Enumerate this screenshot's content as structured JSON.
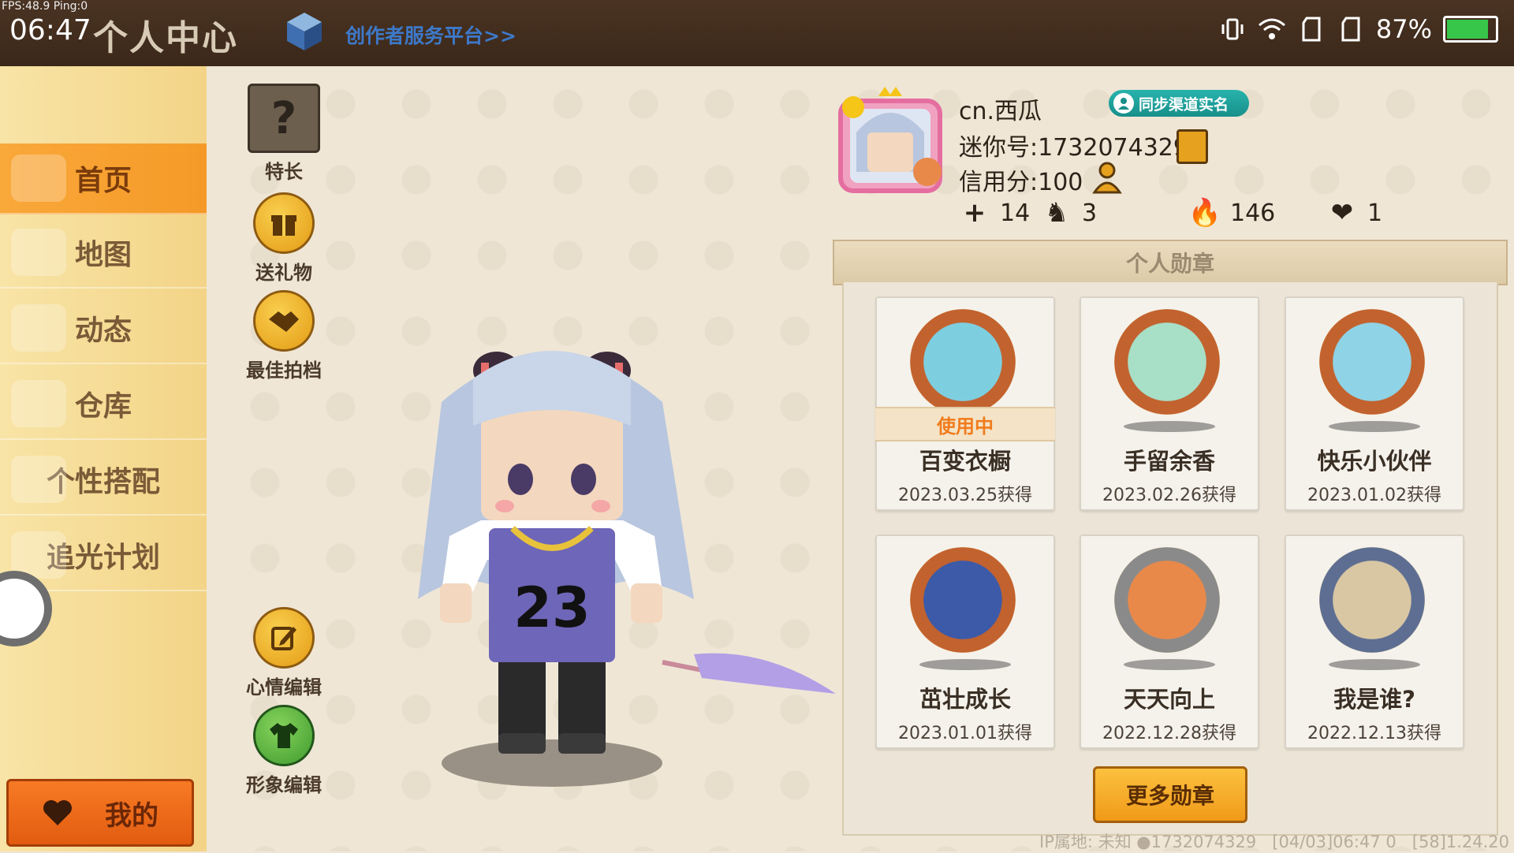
{
  "status_bar": {
    "fps": "FPS:48.9  Ping:0",
    "time": "06:47",
    "battery": "87%"
  },
  "header": {
    "title": "个人中心",
    "creator_link": "创作者服务平台>>"
  },
  "nav": {
    "items": [
      {
        "label": "首页",
        "active": true
      },
      {
        "label": "地图"
      },
      {
        "label": "动态"
      },
      {
        "label": "仓库"
      },
      {
        "label": "个性搭配"
      },
      {
        "label": "追光计划"
      }
    ],
    "mine": "我的"
  },
  "tools": {
    "specialty": "特长",
    "specialty_glyph": "?",
    "gift": "送礼物",
    "best_partner": "最佳拍档",
    "mood_edit": "心情编辑",
    "avatar_edit": "形象编辑"
  },
  "profile": {
    "nickname": "cn.西瓜",
    "sync_label": "同步渠道实名",
    "mini_id": "迷你号:1732074329",
    "credit": "信用分:100",
    "stats": [
      {
        "icon": "add-friend-icon",
        "glyph": "+",
        "value": "14"
      },
      {
        "icon": "fans-icon",
        "glyph": "♞",
        "value": "3"
      },
      {
        "icon": "flame-icon",
        "glyph": "🔥",
        "value": "146"
      },
      {
        "icon": "broken-heart-icon",
        "glyph": "❤",
        "value": "1"
      }
    ]
  },
  "medals": {
    "title": "个人勋章",
    "in_use_label": "使用中",
    "items": [
      {
        "name": "百变衣橱",
        "date": "2023.03.25获得",
        "in_use": true,
        "ring": "#c2622e",
        "inner": "#7dcfe0"
      },
      {
        "name": "手留余香",
        "date": "2023.02.26获得",
        "in_use": false,
        "ring": "#c2622e",
        "inner": "#a8dfc7"
      },
      {
        "name": "快乐小伙伴",
        "date": "2023.01.02获得",
        "in_use": false,
        "ring": "#c2622e",
        "inner": "#8fd3e6"
      },
      {
        "name": "茁壮成长",
        "date": "2023.01.01获得",
        "in_use": false,
        "ring": "#c2622e",
        "inner": "#3c5aa8"
      },
      {
        "name": "天天向上",
        "date": "2022.12.28获得",
        "in_use": false,
        "ring": "#8a8a8a",
        "inner": "#e8894a"
      },
      {
        "name": "我是谁?",
        "date": "2022.12.13获得",
        "in_use": false,
        "ring": "#5e6e92",
        "inner": "#d9c7a4"
      }
    ],
    "more_button": "更多勋章"
  },
  "footer": {
    "ip": "IP属地: 未知",
    "id": "1732074329",
    "time": "[04/03]06:47 0",
    "version": "[58]1.24.20"
  },
  "colors": {
    "accent_orange": "#f59a28",
    "nav_bg": "#f8e4a6",
    "topbar": "#3b281a"
  }
}
